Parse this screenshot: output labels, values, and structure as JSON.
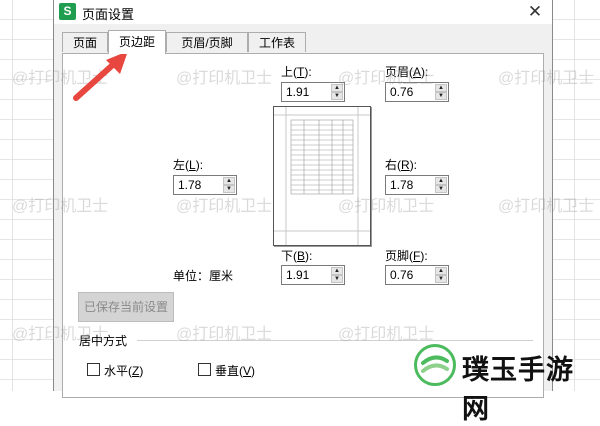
{
  "window": {
    "app_icon": "S",
    "title": "页面设置",
    "close_glyph": "✕"
  },
  "tabs": [
    {
      "label": "页面",
      "active": false
    },
    {
      "label": "页边距",
      "active": true
    },
    {
      "label": "页眉/页脚",
      "active": false
    },
    {
      "label": "工作表",
      "active": false
    }
  ],
  "margins": {
    "top": {
      "label": "上",
      "key": "T",
      "value": "1.91"
    },
    "header": {
      "label": "页眉",
      "key": "A",
      "value": "0.76"
    },
    "left": {
      "label": "左",
      "key": "L",
      "value": "1.78"
    },
    "right": {
      "label": "右",
      "key": "R",
      "value": "1.78"
    },
    "bottom": {
      "label": "下",
      "key": "B",
      "value": "1.91"
    },
    "footer": {
      "label": "页脚",
      "key": "F",
      "value": "0.76"
    }
  },
  "unit": {
    "label": "单位：厘米"
  },
  "save_button": {
    "label": "已保存当前设置",
    "enabled": false
  },
  "center": {
    "group_label": "居中方式",
    "horizontal": {
      "label": "水平",
      "key": "Z",
      "checked": false
    },
    "vertical": {
      "label": "垂直",
      "key": "V",
      "checked": false
    }
  },
  "watermark": {
    "text": "@打印机卫士"
  },
  "brand": {
    "text": "璞玉手游网",
    "accent": "#4cbb5e"
  },
  "annotation": {
    "arrow_color": "#e8473f"
  }
}
